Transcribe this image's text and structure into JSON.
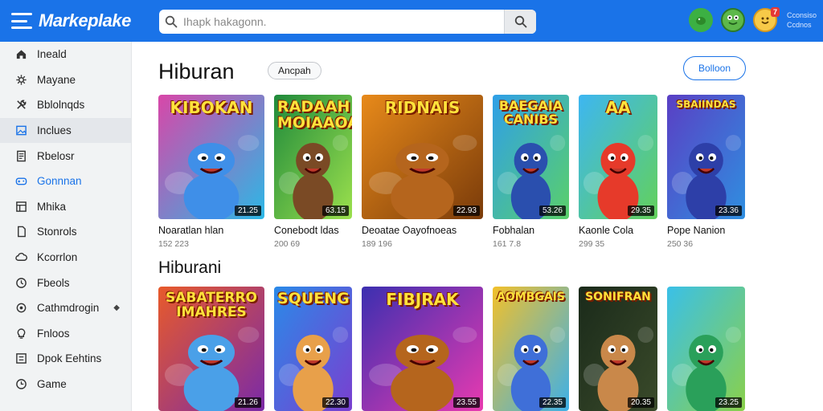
{
  "app": {
    "logo": "Markeplake"
  },
  "search": {
    "placeholder": "Ihapk hakagonn."
  },
  "user": {
    "badge": "7",
    "line1": "Cconsiso",
    "line2": "Ccdnos"
  },
  "sidebar": {
    "items": [
      {
        "label": "Ineald",
        "icon": "home-icon"
      },
      {
        "label": "Mayane",
        "icon": "settings-icon"
      },
      {
        "label": "Bblolnqds",
        "icon": "tools-icon"
      },
      {
        "label": "Inclues",
        "icon": "image-icon"
      },
      {
        "label": "Rbelosr",
        "icon": "document-icon"
      },
      {
        "label": "Gonnnan",
        "icon": "gamepad-icon"
      },
      {
        "label": "Mhika",
        "icon": "store-icon"
      },
      {
        "label": "Stonrols",
        "icon": "file-icon"
      },
      {
        "label": "Kcorrlon",
        "icon": "cloud-icon"
      },
      {
        "label": "Fbeols",
        "icon": "clock-icon"
      },
      {
        "label": "Cathmdrogin",
        "icon": "gear-icon",
        "extra": "◆"
      },
      {
        "label": "Fnloos",
        "icon": "lightbulb-icon"
      },
      {
        "label": "Dpok Eehtins",
        "icon": "menu-list-icon"
      },
      {
        "label": "Game",
        "icon": "history-icon"
      }
    ]
  },
  "main": {
    "section1": {
      "title": "Hiburan",
      "chip": "Ancpah",
      "button": "Bolloon"
    },
    "section2": {
      "title": "Hiburani"
    }
  },
  "cards_row1": [
    {
      "thumb_title": "KIBOKAN",
      "price": "21.25",
      "name": "Noaratlan hlan",
      "meta": "152 223",
      "bg1": "#d946a8",
      "bg2": "#2bb8e6",
      "char": "#3f8fe8"
    },
    {
      "thumb_title": "RADAAH MOIAAOAN",
      "price": "63.15",
      "name": "Conebodt ldas",
      "meta": "200 69",
      "bg1": "#1f8a3b",
      "bg2": "#9be04d",
      "char": "#7a4a25"
    },
    {
      "thumb_title": "RIDNAIS",
      "price": "22.93",
      "name": "Deoatae Oayofnoeas",
      "meta": "189 196",
      "bg1": "#e88a1a",
      "bg2": "#7a3b0a",
      "char": "#b5651d"
    },
    {
      "thumb_title": "BAEGAIA CANIBS",
      "price": "53.26",
      "name": "Fobhalan",
      "meta": "161 7.8",
      "bg1": "#2f9fe8",
      "bg2": "#5ad06a",
      "char": "#2a4fae"
    },
    {
      "thumb_title": "AA",
      "price": "29.35",
      "name": "Kaonle Cola",
      "meta": "299 35",
      "bg1": "#3db6f2",
      "bg2": "#63d15a",
      "char": "#e63a2a"
    },
    {
      "thumb_title": "SBAIINDAS",
      "price": "23.36",
      "name": "Pope Nanion",
      "meta": "250 36",
      "bg1": "#5a3fc4",
      "bg2": "#2f8fe0",
      "char": "#2d3fa8"
    }
  ],
  "cards_row2": [
    {
      "thumb_title": "SABATERRO IMAHRES",
      "price": "21.26",
      "name": "",
      "meta": "",
      "bg1": "#e85a2a",
      "bg2": "#7a2aa8",
      "char": "#4aa0e8"
    },
    {
      "thumb_title": "SQUENG",
      "price": "22.30",
      "name": "",
      "meta": "",
      "bg1": "#2a8ae8",
      "bg2": "#7a3fd0",
      "char": "#e8a04a"
    },
    {
      "thumb_title": "FIBJRAK",
      "price": "23.55",
      "name": "",
      "meta": "",
      "bg1": "#3b2fb0",
      "bg2": "#e83ab0",
      "char": "#b5651d"
    },
    {
      "thumb_title": "AOMBGAIS",
      "price": "22.35",
      "name": "",
      "meta": "",
      "bg1": "#f2c02a",
      "bg2": "#3db0e8",
      "char": "#3f6fd8"
    },
    {
      "thumb_title": "SONIFRAN",
      "price": "20.35",
      "name": "",
      "meta": "",
      "bg1": "#1a2a1a",
      "bg2": "#3a4a2a",
      "char": "#c9884a"
    },
    {
      "thumb_title": "",
      "price": "23.25",
      "name": "",
      "meta": "",
      "bg1": "#3ac0e8",
      "bg2": "#8ad04a",
      "char": "#2aa05a"
    }
  ]
}
